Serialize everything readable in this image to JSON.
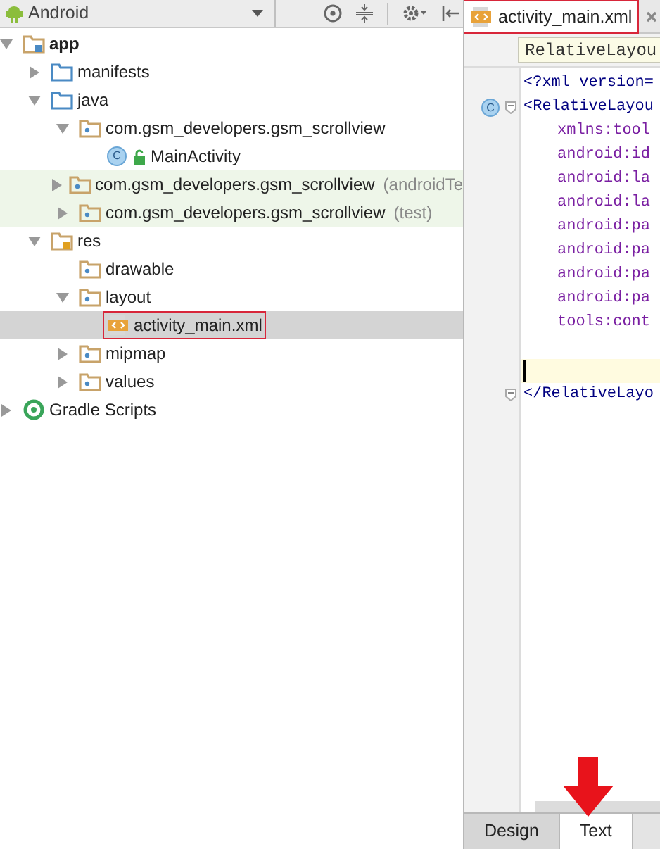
{
  "project_panel": {
    "view_selector": "Android"
  },
  "tree": [
    {
      "label": "app",
      "kind": "module",
      "expanded": true,
      "highlighted": false,
      "selected": false,
      "outlined": false,
      "children": [
        {
          "label": "manifests",
          "kind": "folder",
          "expanded": false,
          "highlighted": false,
          "selected": false,
          "outlined": false
        },
        {
          "label": "java",
          "kind": "folder",
          "expanded": true,
          "highlighted": false,
          "selected": false,
          "outlined": false,
          "children": [
            {
              "label": "com.gsm_developers.gsm_scrollview",
              "kind": "package",
              "expanded": true,
              "highlighted": false,
              "selected": false,
              "outlined": false,
              "children": [
                {
                  "label": "MainActivity",
                  "kind": "class",
                  "icon_letter": "C",
                  "highlighted": false,
                  "selected": false,
                  "outlined": false
                }
              ]
            },
            {
              "label": "com.gsm_developers.gsm_scrollview",
              "suffix": "(androidTe",
              "kind": "package",
              "expanded": false,
              "highlighted": true,
              "selected": false,
              "outlined": false
            },
            {
              "label": "com.gsm_developers.gsm_scrollview",
              "suffix": "(test)",
              "kind": "package",
              "expanded": false,
              "highlighted": true,
              "selected": false,
              "outlined": false
            }
          ]
        },
        {
          "label": "res",
          "kind": "res",
          "expanded": true,
          "highlighted": false,
          "selected": false,
          "outlined": false,
          "children": [
            {
              "label": "drawable",
              "kind": "package",
              "highlighted": false,
              "selected": false,
              "outlined": false
            },
            {
              "label": "layout",
              "kind": "package",
              "expanded": true,
              "highlighted": false,
              "selected": false,
              "outlined": false,
              "children": [
                {
                  "label": "activity_main.xml",
                  "kind": "xml",
                  "highlighted": false,
                  "selected": true,
                  "outlined": true
                }
              ]
            },
            {
              "label": "mipmap",
              "kind": "package",
              "expanded": false,
              "highlighted": false,
              "selected": false,
              "outlined": false
            },
            {
              "label": "values",
              "kind": "package",
              "expanded": false,
              "highlighted": false,
              "selected": false,
              "outlined": false
            }
          ]
        }
      ]
    },
    {
      "label": "Gradle Scripts",
      "kind": "gradle",
      "expanded": false,
      "highlighted": false,
      "selected": false,
      "outlined": false
    }
  ],
  "editor": {
    "tab": {
      "label": "activity_main.xml",
      "outlined": true
    },
    "breadcrumb": "RelativeLayou",
    "lines": [
      {
        "kind": "decl",
        "text": "<?xml version="
      },
      {
        "kind": "tag",
        "text": "<RelativeLayou",
        "gutter": "C",
        "fold": true
      },
      {
        "kind": "attr",
        "text": "xmlns:tool"
      },
      {
        "kind": "attr",
        "text": "android:id"
      },
      {
        "kind": "attr",
        "text": "android:la"
      },
      {
        "kind": "attr",
        "text": "android:la"
      },
      {
        "kind": "attr",
        "text": "android:pa"
      },
      {
        "kind": "attr",
        "text": "android:pa"
      },
      {
        "kind": "attr",
        "text": "android:pa"
      },
      {
        "kind": "attr",
        "text": "android:pa"
      },
      {
        "kind": "attr",
        "text": "tools:cont"
      },
      {
        "kind": "blank"
      },
      {
        "kind": "cursor"
      },
      {
        "kind": "tag",
        "text": "</RelativeLayo",
        "fold": true
      }
    ],
    "bottom_tabs": [
      {
        "label": "Design",
        "selected": false
      },
      {
        "label": "Text",
        "selected": true
      }
    ]
  }
}
